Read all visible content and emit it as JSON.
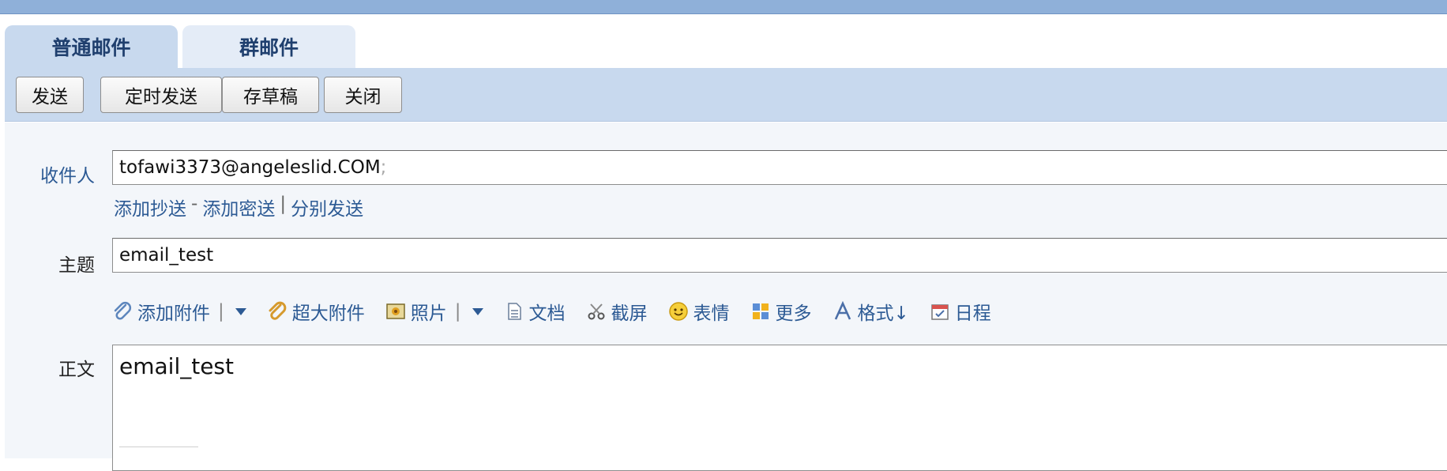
{
  "tabs": [
    {
      "label": "普通邮件",
      "active": true
    },
    {
      "label": "群邮件",
      "active": false
    }
  ],
  "toolbar": {
    "send": "发送",
    "scheduled_send": "定时发送",
    "save_draft": "存草稿",
    "close": "关闭"
  },
  "form": {
    "to_label": "收件人",
    "to_value": "tofawi3373@angeleslid.COM",
    "to_separator": ";",
    "add_cc": "添加抄送",
    "add_cc_separator": "-",
    "add_bcc": "添加密送",
    "link_divider": "|",
    "send_separately": "分别发送",
    "subject_label": "主题",
    "subject_value": "email_test",
    "body_label": "正文",
    "body_value": "email_test"
  },
  "attach_bar": {
    "add_attachment": "添加附件",
    "large_attachment": "超大附件",
    "photo": "照片",
    "document": "文档",
    "screenshot": "截屏",
    "emoji": "表情",
    "more": "更多",
    "format": "格式↓",
    "schedule": "日程"
  },
  "colors": {
    "top_bar": "#8fb0d9",
    "toolbar_bg": "#c8d9ee",
    "link": "#2c5a94"
  }
}
